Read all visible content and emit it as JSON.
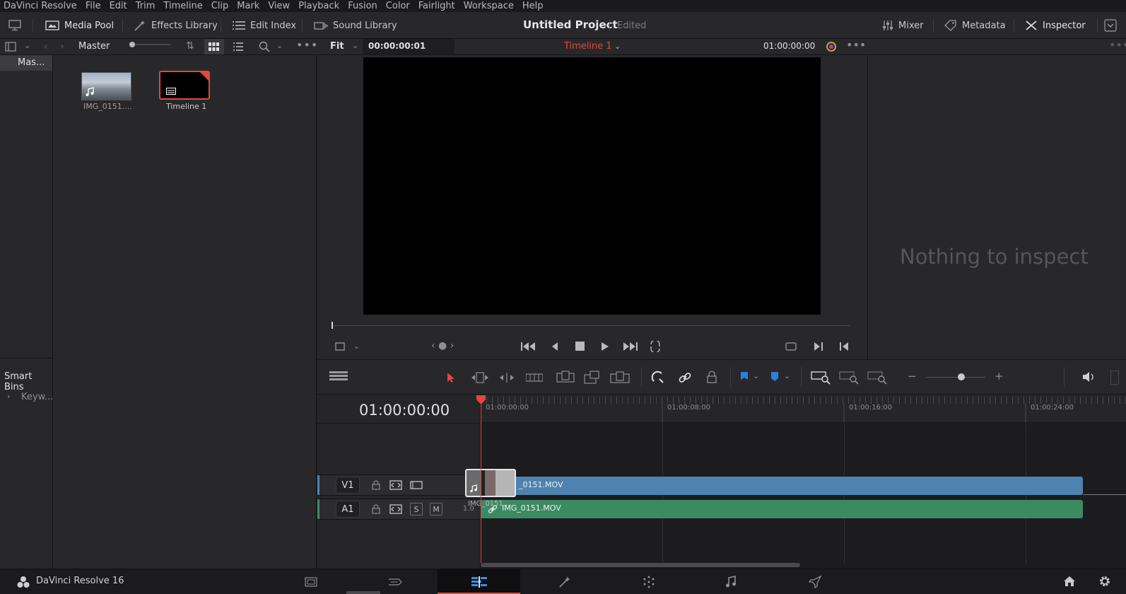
{
  "menu": [
    "DaVinci Resolve",
    "File",
    "Edit",
    "Trim",
    "Timeline",
    "Clip",
    "Mark",
    "View",
    "Playback",
    "Fusion",
    "Color",
    "Fairlight",
    "Workspace",
    "Help"
  ],
  "toolbar": {
    "media_pool": "Media Pool",
    "effects_library": "Effects Library",
    "edit_index": "Edit Index",
    "sound_library": "Sound Library",
    "project_title": "Untitled Project",
    "project_status": "Edited",
    "mixer": "Mixer",
    "metadata": "Metadata",
    "inspector": "Inspector"
  },
  "media_pool": {
    "bin_name": "Master",
    "master_bin": "Mas...",
    "smart_bins": "Smart Bins",
    "keywords": "Keyw...",
    "clips": [
      {
        "label": "IMG_0151...."
      },
      {
        "label": "Timeline 1"
      }
    ]
  },
  "viewer": {
    "zoom": "Fit",
    "source_timecode": "00:00:00:01",
    "timeline_name": "Timeline 1",
    "record_timecode": "01:00:00:00"
  },
  "inspector": {
    "empty_message": "Nothing to inspect"
  },
  "timeline": {
    "current_timecode": "01:00:00:00",
    "ruler_marks": [
      "01:00:00:00",
      "01:00:08:00",
      "01:00:16:00",
      "01:00:24:00"
    ],
    "tracks": [
      {
        "name": "V1",
        "clip": "_0151.MOV",
        "thumb_label": "IMG_0151...."
      },
      {
        "name": "A1",
        "clip": "IMG_0151.MOV",
        "solo": "S",
        "mute": "M",
        "level": "1.0"
      }
    ]
  },
  "bottom": {
    "app_name": "DaVinci Resolve 16"
  }
}
